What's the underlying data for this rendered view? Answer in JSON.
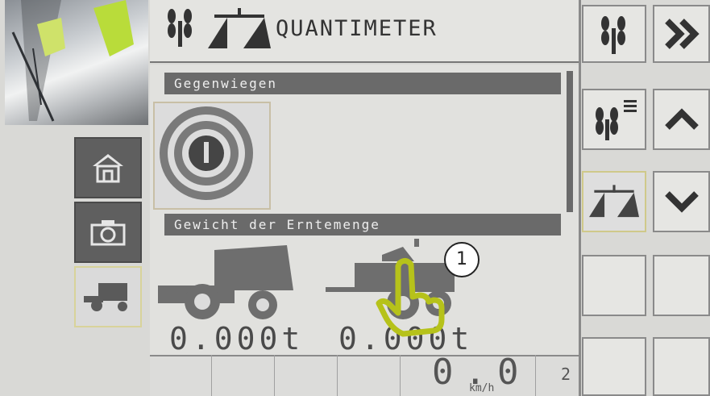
{
  "header": {
    "title": "QUANTIMETER"
  },
  "sections": {
    "tare_label": "Gegenwiegen",
    "weight_label": "Gewicht der Erntemenge"
  },
  "weights": {
    "combine_value": "0.000t",
    "trailer_value": "0.000t"
  },
  "status_bar": {
    "speed_value": "0.0",
    "speed_unit": "km/h",
    "gear_value": "2"
  },
  "annotation": {
    "callout_number": "1"
  },
  "left_tabs": [
    {
      "icon": "home-icon"
    },
    {
      "icon": "camera-icon"
    },
    {
      "icon": "combine-harvester-icon",
      "selected": true
    }
  ],
  "right_buttons": [
    {
      "icon": "grain-icon"
    },
    {
      "icon": "double-chevron-right-icon"
    },
    {
      "icon": "grain-list-icon"
    },
    {
      "icon": "chevron-up-icon"
    },
    {
      "icon": "scale-icon",
      "selected": true
    },
    {
      "icon": "chevron-down-icon"
    }
  ],
  "colors": {
    "screen_bg": "#d9d9d6",
    "dark_bar": "#6a6a6a",
    "selection_outline": "#cfc98a",
    "touch_hint": "#b6c21a"
  }
}
